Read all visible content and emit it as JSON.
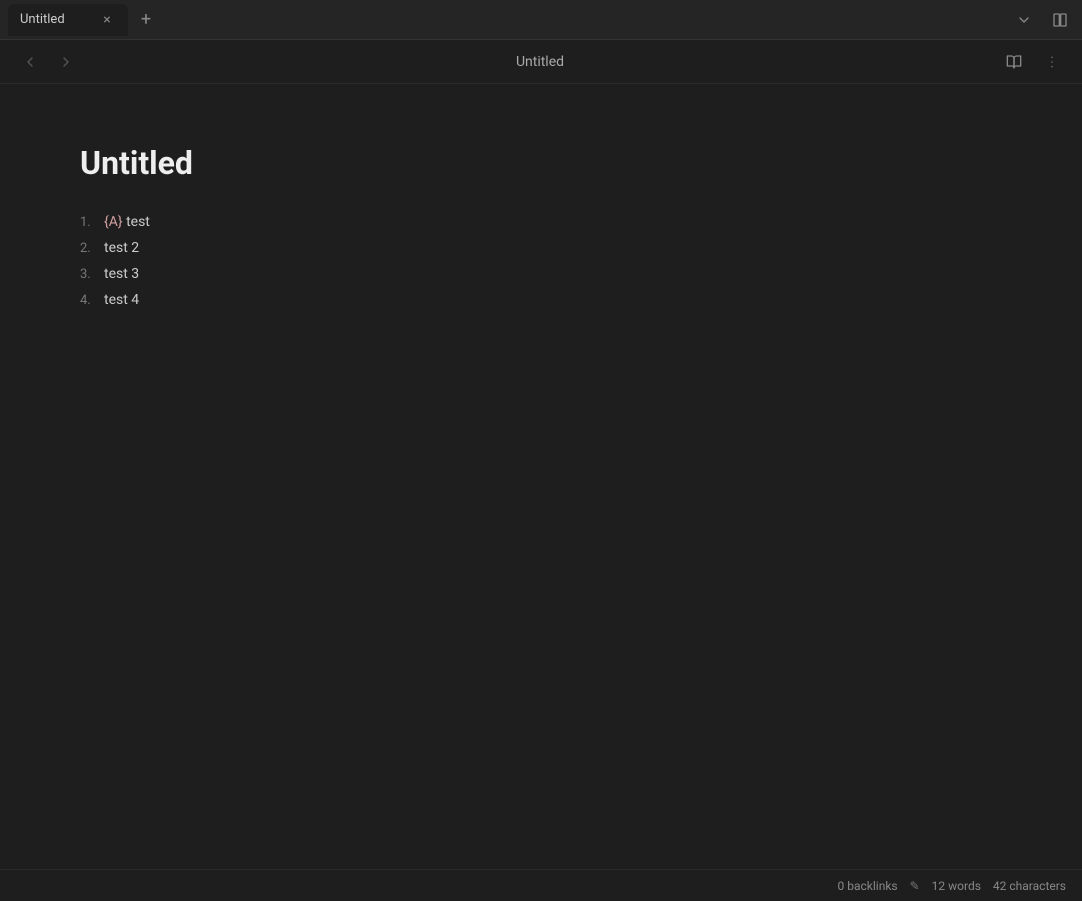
{
  "tab": {
    "title": "Untitled",
    "close_label": "×"
  },
  "toolbar": {
    "title": "Untitled",
    "new_tab_label": "+",
    "chevron_down": "⌄"
  },
  "document": {
    "title": "Untitled",
    "list_items": [
      {
        "num": "1.",
        "text": "{A} test",
        "has_cursor": true
      },
      {
        "num": "2.",
        "text": "test 2",
        "has_cursor": false
      },
      {
        "num": "3.",
        "text": "test 3",
        "has_cursor": false
      },
      {
        "num": "4.",
        "text": "test 4",
        "has_cursor": false
      }
    ]
  },
  "status_bar": {
    "backlinks_label": "0 backlinks",
    "words_label": "12 words",
    "characters_label": "42 characters",
    "edit_icon": "✎"
  }
}
